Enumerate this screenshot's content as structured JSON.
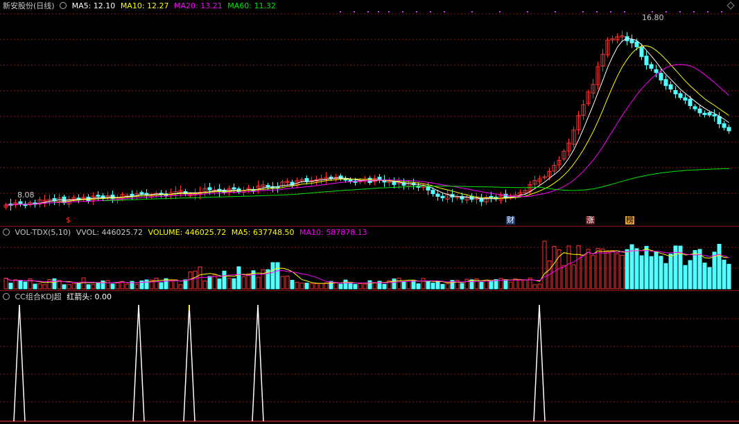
{
  "main": {
    "title": "新安股份(日线)",
    "ma5": "MA5: 12.10",
    "ma10": "MA10: 12.27",
    "ma20": "MA20: 13.21",
    "ma60": "MA60: 11.32",
    "high_label": "16.80",
    "low_label": "8.08",
    "event_s": "$",
    "event_cai": "财",
    "event_zhang": "涨",
    "event_bang": "榜"
  },
  "vol": {
    "title": "VOL-TDX(5,10)",
    "vvol": "VVOL: 446025.72",
    "volume": "VOLUME: 446025.72",
    "ma5": "MA5: 637748.50",
    "ma10": "MA10: 587878.13"
  },
  "kdj": {
    "title": "CC组合KDJ超",
    "arrow": "红箭头: 0.00"
  },
  "colors": {
    "up": "#ff3232",
    "down": "#54ffff",
    "ma5": "#ffffff",
    "ma10": "#ffff00",
    "ma20": "#ff00ff",
    "ma60": "#00e600",
    "grid": "#8c1a1a"
  }
}
